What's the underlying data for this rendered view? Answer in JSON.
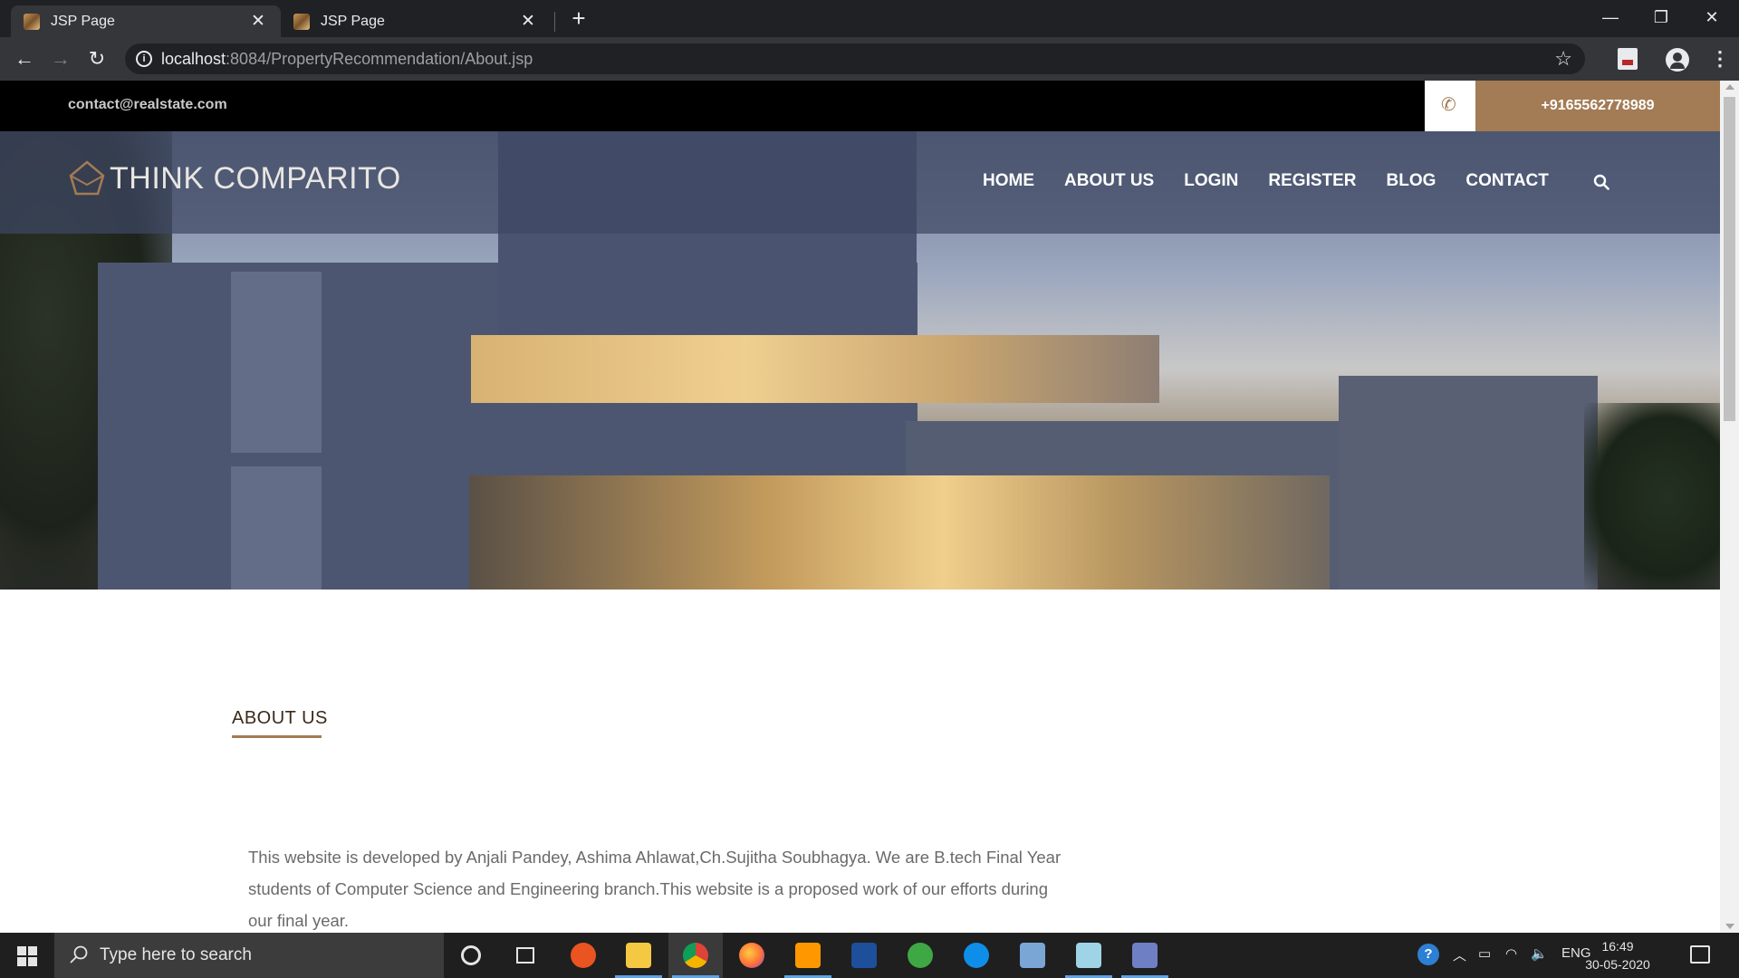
{
  "browser": {
    "tabs": [
      {
        "title": "JSP Page",
        "active": true
      },
      {
        "title": "JSP Page",
        "active": false
      }
    ],
    "url_host": "localhost",
    "url_path": ":8084/PropertyRecommendation/About.jsp"
  },
  "site": {
    "email": "contact@realstate.com",
    "phone": "+9165562778989",
    "brand": "THINK COMPARITO",
    "nav": [
      "HOME",
      "ABOUT US",
      "LOGIN",
      "REGISTER",
      "BLOG",
      "CONTACT"
    ],
    "accent_color": "#a37b55"
  },
  "about": {
    "title": "ABOUT US",
    "text": "This website is developed by Anjali Pandey, Ashima Ahlawat,Ch.Sujitha Soubhagya. We are B.tech Final Year students of Computer Science and Engineering branch.This website is a proposed work of our efforts during our final year."
  },
  "taskbar": {
    "search_placeholder": "Type here to search",
    "apps": [
      "cortana-icon",
      "task-view-icon",
      "ubuntu-icon",
      "file-explorer-icon",
      "chrome-icon",
      "firefox-icon",
      "sublime-text-icon",
      "devcpp-icon",
      "utorrent-icon",
      "teamviewer-icon",
      "virtualbox-icon",
      "notepad-icon",
      "netbeans-icon"
    ],
    "language": "ENG",
    "time": "16:49",
    "date": "30-05-2020"
  }
}
